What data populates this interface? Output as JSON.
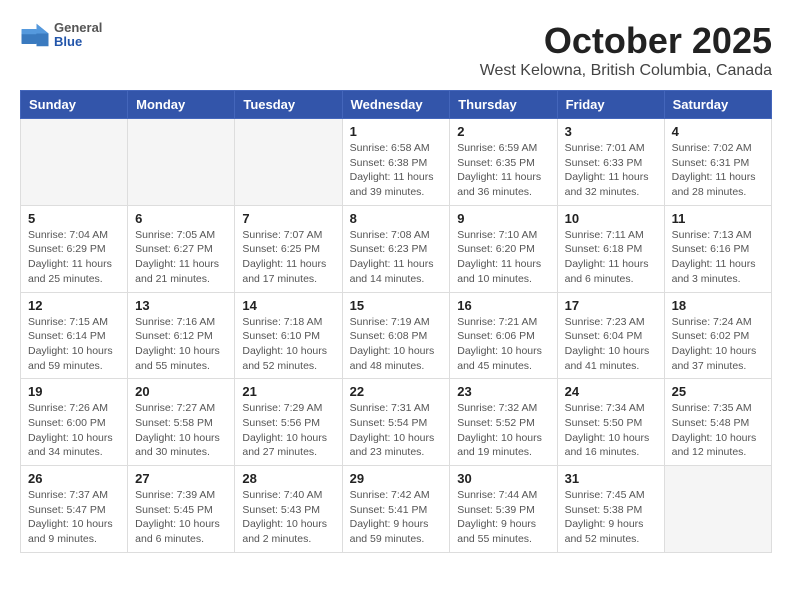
{
  "header": {
    "logo_general": "General",
    "logo_blue": "Blue",
    "month_title": "October 2025",
    "subtitle": "West Kelowna, British Columbia, Canada"
  },
  "days_of_week": [
    "Sunday",
    "Monday",
    "Tuesday",
    "Wednesday",
    "Thursday",
    "Friday",
    "Saturday"
  ],
  "weeks": [
    [
      {
        "day": "",
        "info": ""
      },
      {
        "day": "",
        "info": ""
      },
      {
        "day": "",
        "info": ""
      },
      {
        "day": "1",
        "info": "Sunrise: 6:58 AM\nSunset: 6:38 PM\nDaylight: 11 hours\nand 39 minutes."
      },
      {
        "day": "2",
        "info": "Sunrise: 6:59 AM\nSunset: 6:35 PM\nDaylight: 11 hours\nand 36 minutes."
      },
      {
        "day": "3",
        "info": "Sunrise: 7:01 AM\nSunset: 6:33 PM\nDaylight: 11 hours\nand 32 minutes."
      },
      {
        "day": "4",
        "info": "Sunrise: 7:02 AM\nSunset: 6:31 PM\nDaylight: 11 hours\nand 28 minutes."
      }
    ],
    [
      {
        "day": "5",
        "info": "Sunrise: 7:04 AM\nSunset: 6:29 PM\nDaylight: 11 hours\nand 25 minutes."
      },
      {
        "day": "6",
        "info": "Sunrise: 7:05 AM\nSunset: 6:27 PM\nDaylight: 11 hours\nand 21 minutes."
      },
      {
        "day": "7",
        "info": "Sunrise: 7:07 AM\nSunset: 6:25 PM\nDaylight: 11 hours\nand 17 minutes."
      },
      {
        "day": "8",
        "info": "Sunrise: 7:08 AM\nSunset: 6:23 PM\nDaylight: 11 hours\nand 14 minutes."
      },
      {
        "day": "9",
        "info": "Sunrise: 7:10 AM\nSunset: 6:20 PM\nDaylight: 11 hours\nand 10 minutes."
      },
      {
        "day": "10",
        "info": "Sunrise: 7:11 AM\nSunset: 6:18 PM\nDaylight: 11 hours\nand 6 minutes."
      },
      {
        "day": "11",
        "info": "Sunrise: 7:13 AM\nSunset: 6:16 PM\nDaylight: 11 hours\nand 3 minutes."
      }
    ],
    [
      {
        "day": "12",
        "info": "Sunrise: 7:15 AM\nSunset: 6:14 PM\nDaylight: 10 hours\nand 59 minutes."
      },
      {
        "day": "13",
        "info": "Sunrise: 7:16 AM\nSunset: 6:12 PM\nDaylight: 10 hours\nand 55 minutes."
      },
      {
        "day": "14",
        "info": "Sunrise: 7:18 AM\nSunset: 6:10 PM\nDaylight: 10 hours\nand 52 minutes."
      },
      {
        "day": "15",
        "info": "Sunrise: 7:19 AM\nSunset: 6:08 PM\nDaylight: 10 hours\nand 48 minutes."
      },
      {
        "day": "16",
        "info": "Sunrise: 7:21 AM\nSunset: 6:06 PM\nDaylight: 10 hours\nand 45 minutes."
      },
      {
        "day": "17",
        "info": "Sunrise: 7:23 AM\nSunset: 6:04 PM\nDaylight: 10 hours\nand 41 minutes."
      },
      {
        "day": "18",
        "info": "Sunrise: 7:24 AM\nSunset: 6:02 PM\nDaylight: 10 hours\nand 37 minutes."
      }
    ],
    [
      {
        "day": "19",
        "info": "Sunrise: 7:26 AM\nSunset: 6:00 PM\nDaylight: 10 hours\nand 34 minutes."
      },
      {
        "day": "20",
        "info": "Sunrise: 7:27 AM\nSunset: 5:58 PM\nDaylight: 10 hours\nand 30 minutes."
      },
      {
        "day": "21",
        "info": "Sunrise: 7:29 AM\nSunset: 5:56 PM\nDaylight: 10 hours\nand 27 minutes."
      },
      {
        "day": "22",
        "info": "Sunrise: 7:31 AM\nSunset: 5:54 PM\nDaylight: 10 hours\nand 23 minutes."
      },
      {
        "day": "23",
        "info": "Sunrise: 7:32 AM\nSunset: 5:52 PM\nDaylight: 10 hours\nand 19 minutes."
      },
      {
        "day": "24",
        "info": "Sunrise: 7:34 AM\nSunset: 5:50 PM\nDaylight: 10 hours\nand 16 minutes."
      },
      {
        "day": "25",
        "info": "Sunrise: 7:35 AM\nSunset: 5:48 PM\nDaylight: 10 hours\nand 12 minutes."
      }
    ],
    [
      {
        "day": "26",
        "info": "Sunrise: 7:37 AM\nSunset: 5:47 PM\nDaylight: 10 hours\nand 9 minutes."
      },
      {
        "day": "27",
        "info": "Sunrise: 7:39 AM\nSunset: 5:45 PM\nDaylight: 10 hours\nand 6 minutes."
      },
      {
        "day": "28",
        "info": "Sunrise: 7:40 AM\nSunset: 5:43 PM\nDaylight: 10 hours\nand 2 minutes."
      },
      {
        "day": "29",
        "info": "Sunrise: 7:42 AM\nSunset: 5:41 PM\nDaylight: 9 hours\nand 59 minutes."
      },
      {
        "day": "30",
        "info": "Sunrise: 7:44 AM\nSunset: 5:39 PM\nDaylight: 9 hours\nand 55 minutes."
      },
      {
        "day": "31",
        "info": "Sunrise: 7:45 AM\nSunset: 5:38 PM\nDaylight: 9 hours\nand 52 minutes."
      },
      {
        "day": "",
        "info": ""
      }
    ]
  ]
}
